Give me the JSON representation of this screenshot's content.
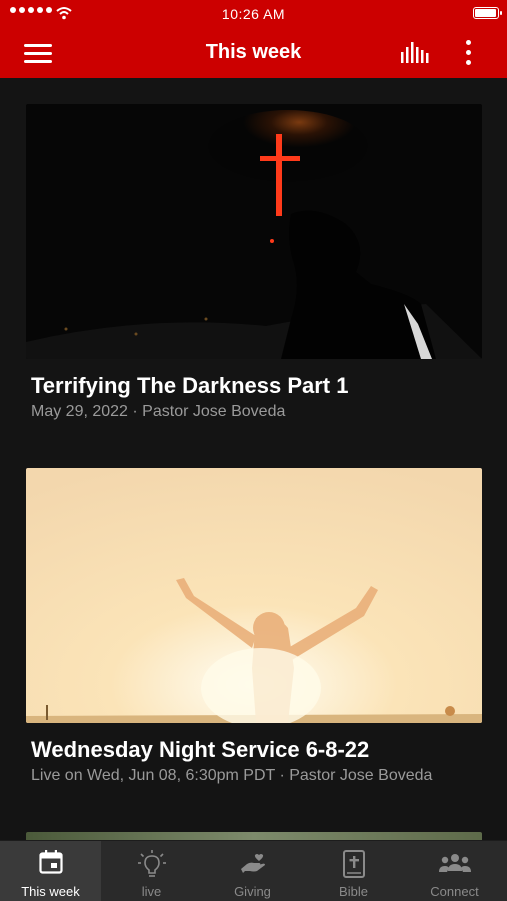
{
  "status_bar": {
    "time": "10:26 AM",
    "battery_level": 0.95
  },
  "nav": {
    "title": "This week"
  },
  "cards": [
    {
      "title": "Terrifying The Darkness Part 1",
      "meta": "May 29, 2022 · Pastor Jose Boveda"
    },
    {
      "title": "Wednesday Night Service 6-8-22",
      "meta": "Live on Wed, Jun 08, 6:30pm PDT · Pastor Jose Boveda"
    }
  ],
  "tabs": [
    {
      "label": "This week",
      "icon": "calendar-icon",
      "active": true
    },
    {
      "label": "live",
      "icon": "lightbulb-icon",
      "active": false
    },
    {
      "label": "Giving",
      "icon": "giving-hand-icon",
      "active": false
    },
    {
      "label": "Bible",
      "icon": "bible-icon",
      "active": false
    },
    {
      "label": "Connect",
      "icon": "people-icon",
      "active": false
    }
  ],
  "colors": {
    "brand_red": "#cc0000",
    "background": "#141414",
    "tabbar": "#2a2a2a"
  }
}
